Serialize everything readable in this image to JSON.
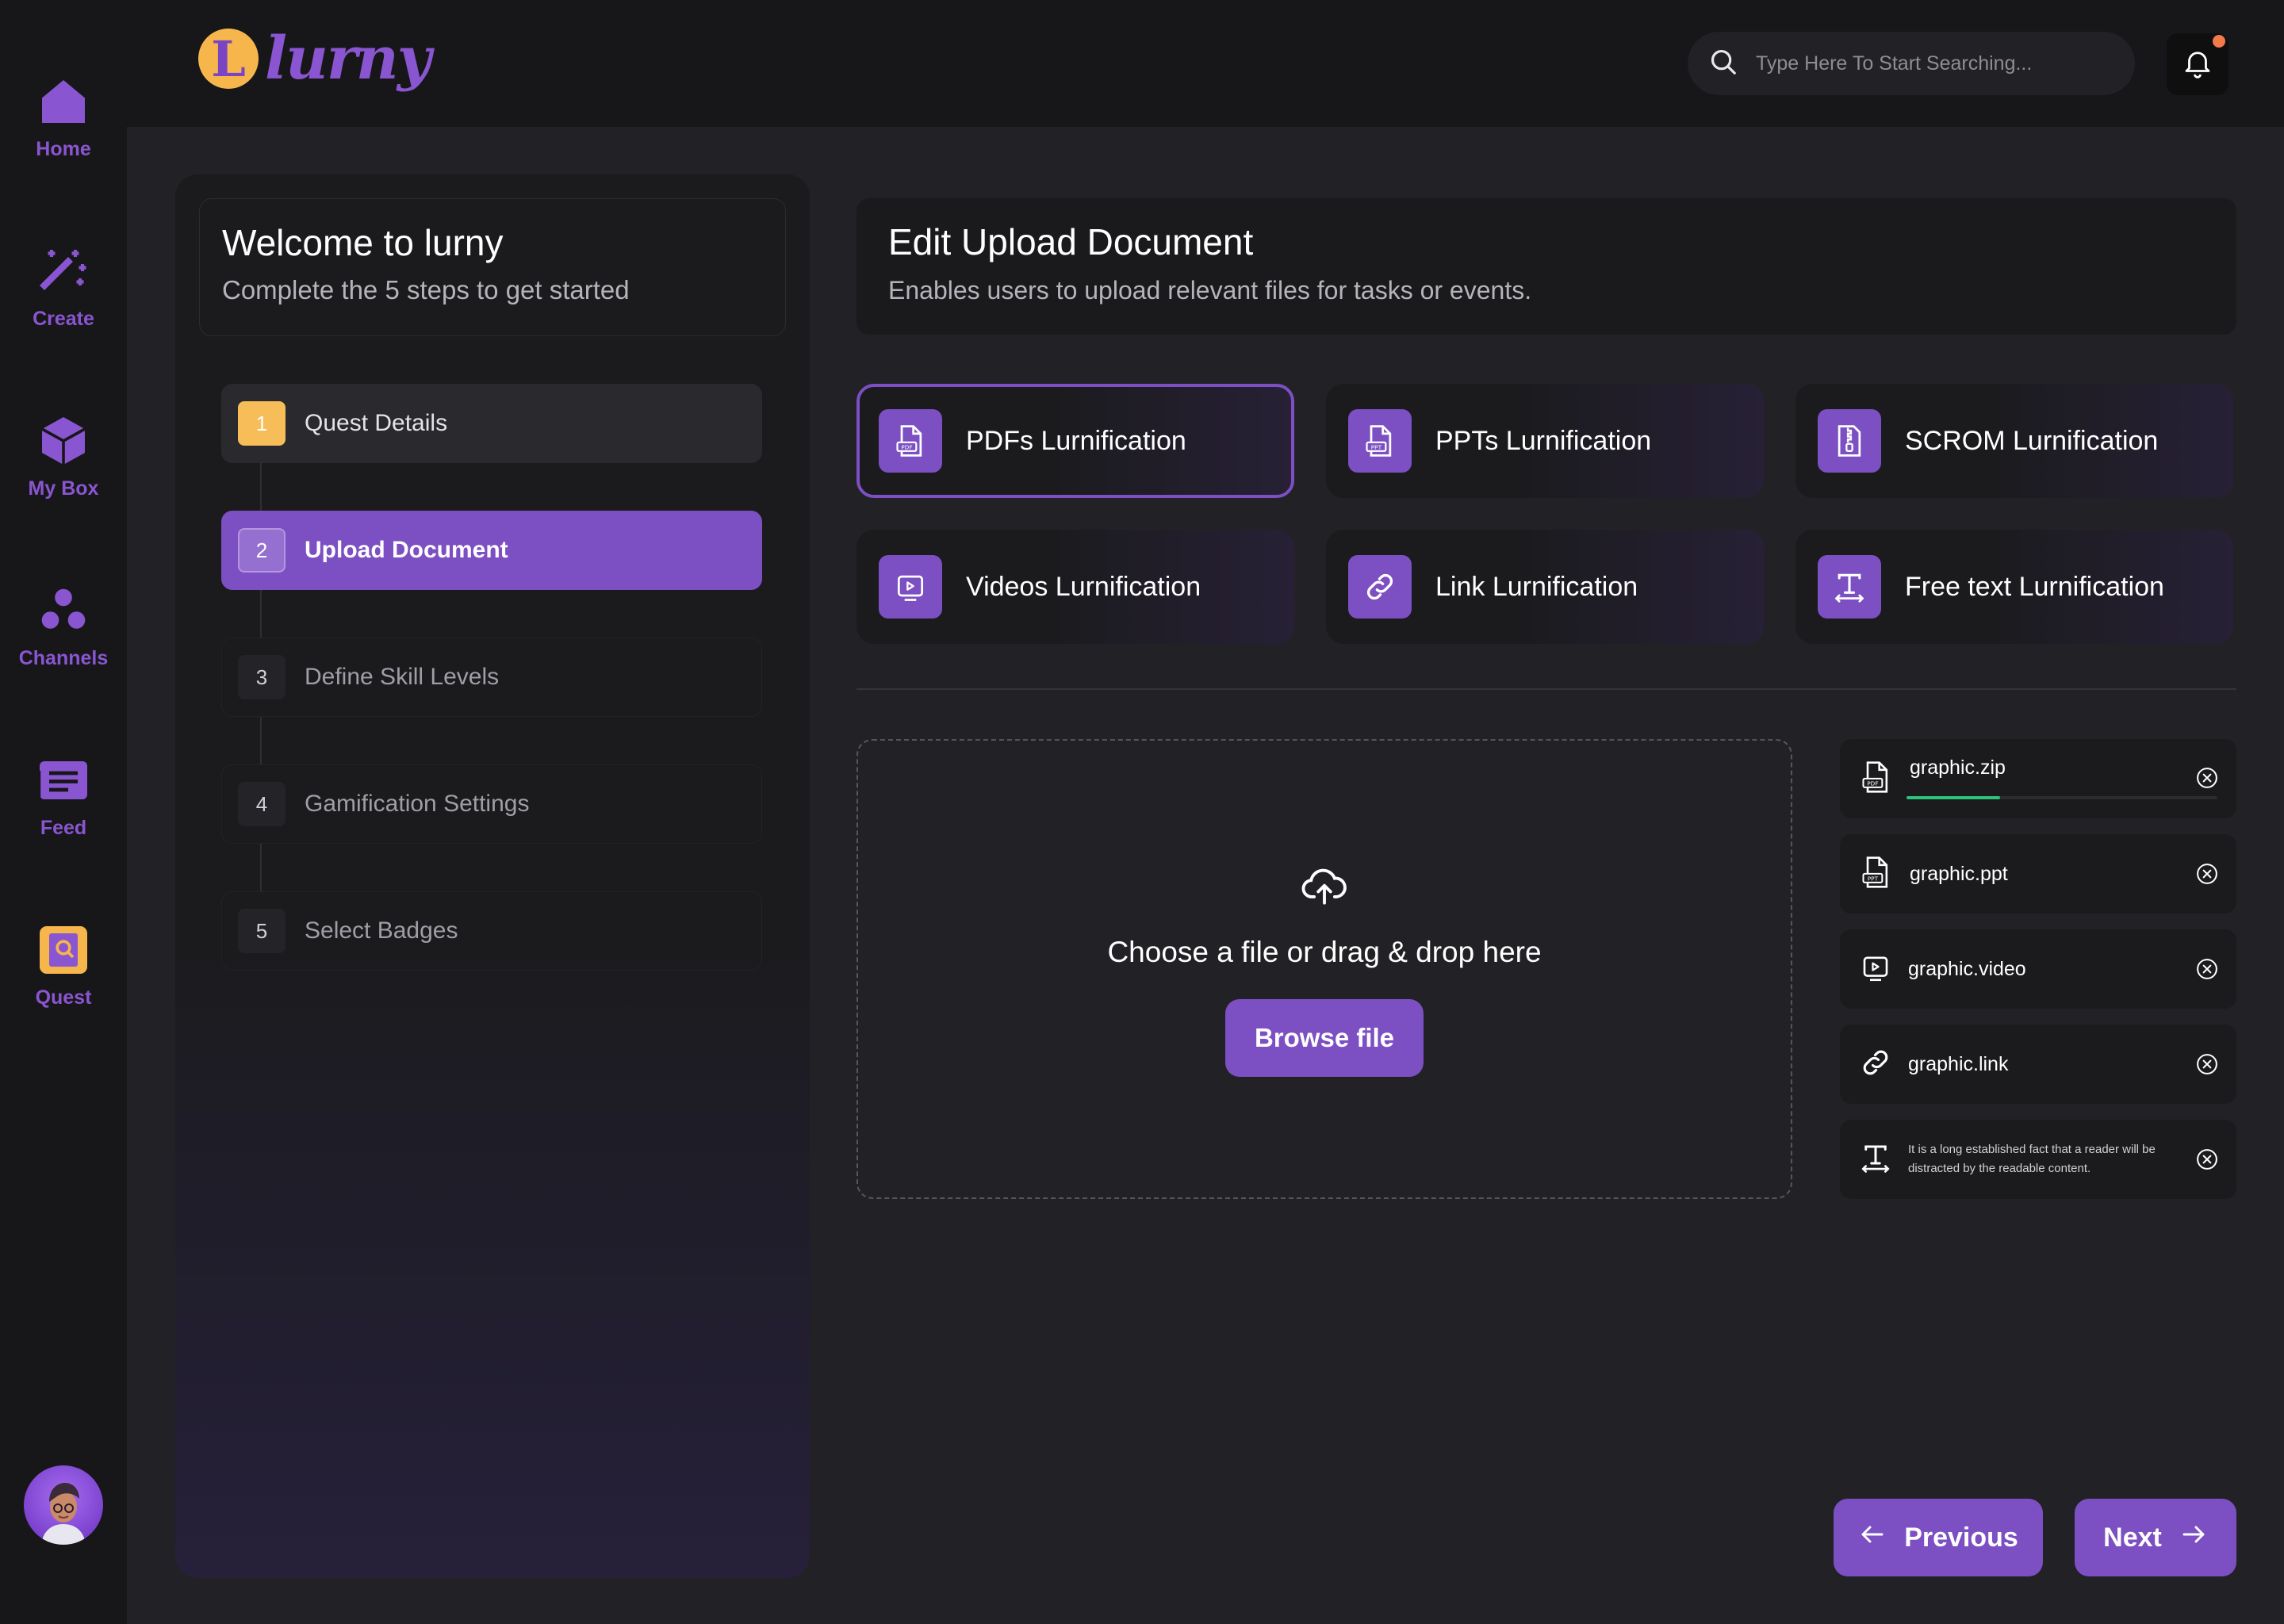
{
  "brand": {
    "logo_letter": "L",
    "logo_text": "lurny"
  },
  "sidebar": {
    "items": [
      {
        "label": "Home",
        "icon": "home-icon"
      },
      {
        "label": "Create",
        "icon": "magic-wand-icon"
      },
      {
        "label": "My Box",
        "icon": "box-icon"
      },
      {
        "label": "Channels",
        "icon": "channels-icon"
      },
      {
        "label": "Feed",
        "icon": "feed-icon"
      },
      {
        "label": "Quest",
        "icon": "quest-book-icon"
      }
    ]
  },
  "search": {
    "placeholder": "Type Here To Start Searching..."
  },
  "welcome": {
    "title": "Welcome to lurny",
    "subtitle": "Complete the 5 steps to get started"
  },
  "steps": [
    {
      "number": "1",
      "label": "Quest Details",
      "state": "done"
    },
    {
      "number": "2",
      "label": "Upload Document",
      "state": "active"
    },
    {
      "number": "3",
      "label": "Define Skill Levels",
      "state": "pending"
    },
    {
      "number": "4",
      "label": "Gamification Settings",
      "state": "pending"
    },
    {
      "number": "5",
      "label": "Select Badges",
      "state": "pending"
    }
  ],
  "main": {
    "title": "Edit Upload Document",
    "subtitle": "Enables users to upload relevant files for tasks or events."
  },
  "types": [
    {
      "label": "PDFs Lurnification",
      "icon": "pdf-file-icon",
      "selected": true
    },
    {
      "label": "PPTs Lurnification",
      "icon": "ppt-file-icon",
      "selected": false
    },
    {
      "label": "SCROM Lurnification",
      "icon": "zip-file-icon",
      "selected": false
    },
    {
      "label": "Videos Lurnification",
      "icon": "video-icon",
      "selected": false
    },
    {
      "label": "Link Lurnification",
      "icon": "link-icon",
      "selected": false
    },
    {
      "label": "Free text Lurnification",
      "icon": "text-icon",
      "selected": false
    }
  ],
  "dropzone": {
    "text": "Choose a file or drag & drop here",
    "button": "Browse file"
  },
  "files": [
    {
      "name": "graphic.zip",
      "icon": "pdf-file-icon",
      "progress": 0.3
    },
    {
      "name": "graphic.ppt",
      "icon": "ppt-file-icon"
    },
    {
      "name": "graphic.video",
      "icon": "video-icon"
    },
    {
      "name": "graphic.link",
      "icon": "link-icon"
    },
    {
      "name": "It is a long established fact that a reader will be distracted by the readable content.",
      "icon": "text-icon"
    }
  ],
  "footer": {
    "previous": "Previous",
    "next": "Next"
  },
  "colors": {
    "accent": "#7c4fc2",
    "brand_yellow": "#f6b64c",
    "progress": "#2ec27a",
    "notification": "#f27a4a"
  }
}
